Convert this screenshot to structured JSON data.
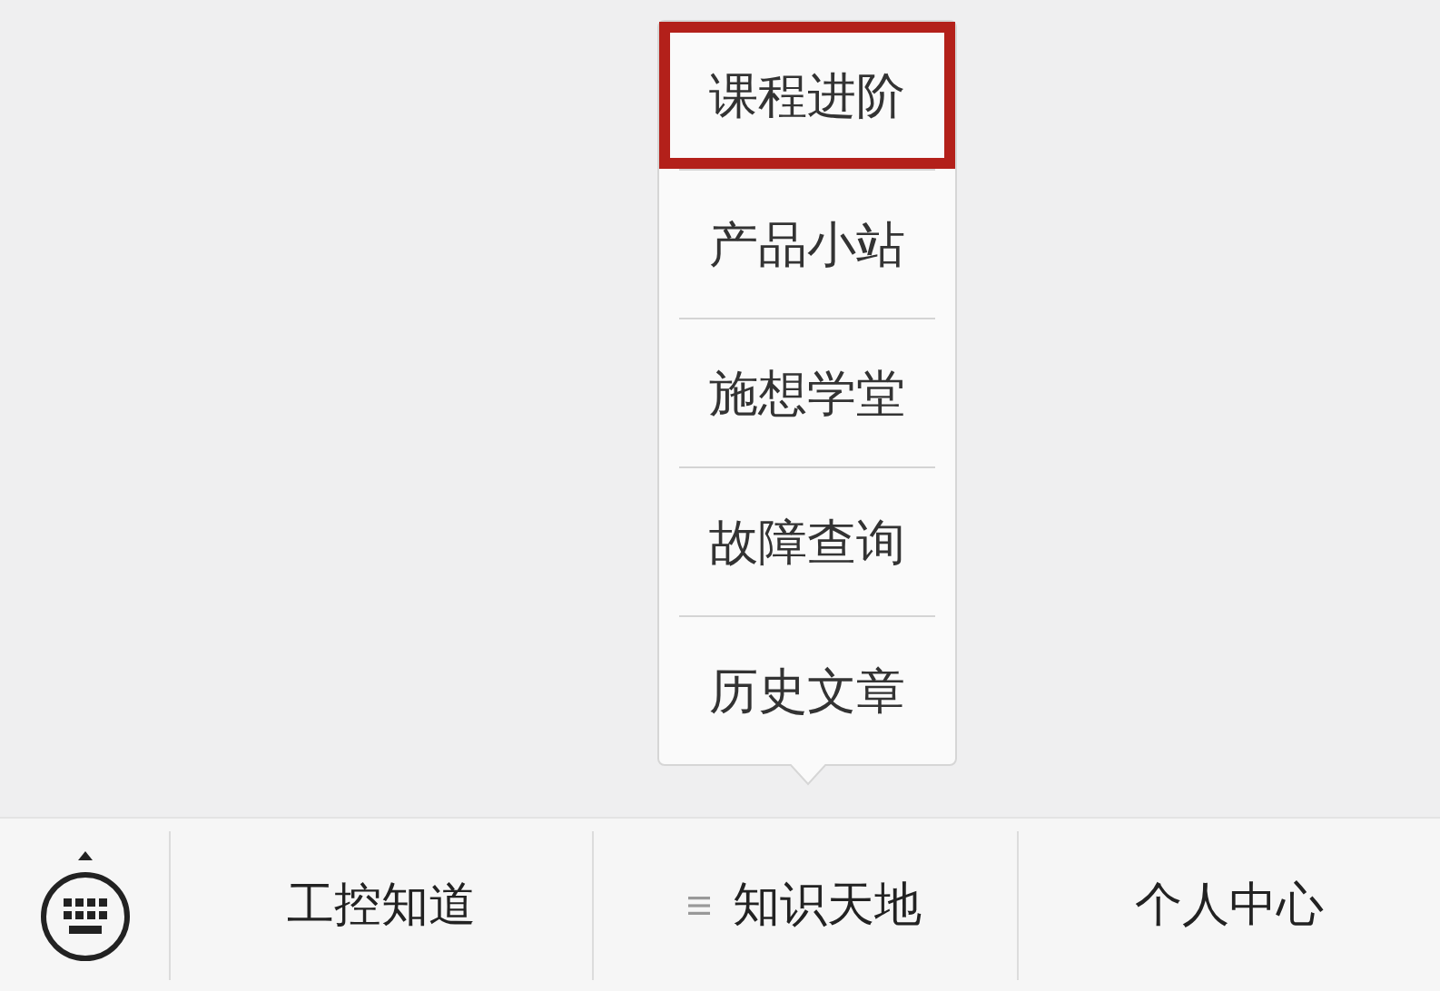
{
  "menu": {
    "items": [
      {
        "label": "课程进阶",
        "selected": true
      },
      {
        "label": "产品小站",
        "selected": false
      },
      {
        "label": "施想学堂",
        "selected": false
      },
      {
        "label": "故障查询",
        "selected": false
      },
      {
        "label": "历史文章",
        "selected": false
      }
    ]
  },
  "bottom_bar": {
    "tabs": [
      {
        "label": "工控知道",
        "has_submenu": false
      },
      {
        "label": "知识天地",
        "has_submenu": true
      },
      {
        "label": "个人中心",
        "has_submenu": false
      }
    ]
  }
}
